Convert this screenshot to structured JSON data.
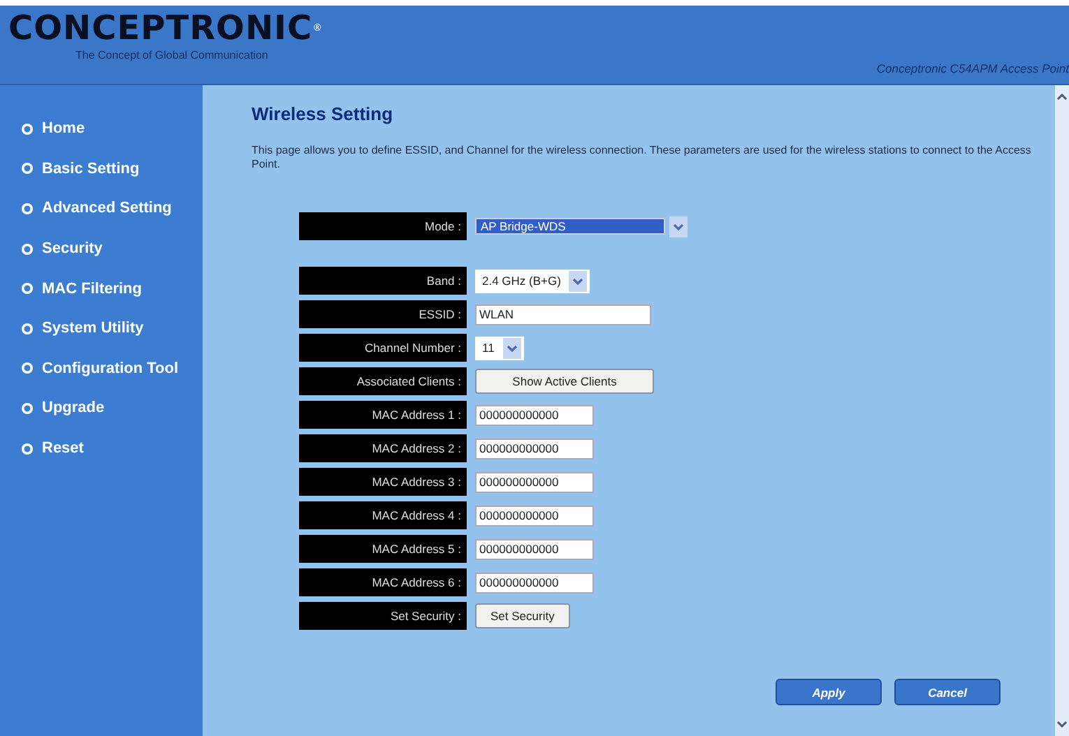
{
  "header": {
    "logo": "CONCEPTRONIC$^{®}$",
    "tagline": "The Concept of Global Communication",
    "product": "Conceptronic C54APM Access Point"
  },
  "sidebar": {
    "items": [
      {
        "label": "Home"
      },
      {
        "label": "Basic Setting"
      },
      {
        "label": "Advanced Setting"
      },
      {
        "label": "Security"
      },
      {
        "label": "MAC Filtering"
      },
      {
        "label": "System Utility"
      },
      {
        "label": "Configuration Tool"
      },
      {
        "label": "Upgrade"
      },
      {
        "label": "Reset"
      }
    ]
  },
  "page": {
    "title": "Wireless Setting",
    "description": "This page allows you to define ESSID, and Channel for the wireless connection. These parameters are used for the wireless stations to connect to the Access Point."
  },
  "form": {
    "rows": [
      {
        "kind": "select",
        "label": "Mode :",
        "value": "AP Bridge-WDS",
        "focused": true,
        "gap_after": true
      },
      {
        "kind": "select",
        "label": "Band :",
        "value": "2.4 GHz (B+G)",
        "focused": false
      },
      {
        "kind": "input",
        "label": "ESSID :",
        "value": "WLAN",
        "focused": false
      },
      {
        "kind": "select",
        "label": "Channel Number :",
        "value": "11",
        "focused": false
      },
      {
        "kind": "button",
        "label": "Associated Clients :",
        "value": "Show Active Clients",
        "focused": false
      },
      {
        "kind": "input",
        "label": "MAC Address 1 :",
        "value": "000000000000",
        "focused": false
      },
      {
        "kind": "input",
        "label": "MAC Address 2 :",
        "value": "000000000000",
        "focused": false
      },
      {
        "kind": "input",
        "label": "MAC Address 3 :",
        "value": "000000000000",
        "focused": false
      },
      {
        "kind": "input",
        "label": "MAC Address 4 :",
        "value": "000000000000",
        "focused": false
      },
      {
        "kind": "input",
        "label": "MAC Address 5 :",
        "value": "000000000000",
        "focused": false
      },
      {
        "kind": "input",
        "label": "MAC Address 6 :",
        "value": "000000000000",
        "focused": false
      },
      {
        "kind": "button",
        "label": "Set Security :",
        "value": "Set Security",
        "focused": false
      }
    ]
  },
  "buttons": [
    "Apply",
    "Cancel"
  ]
}
